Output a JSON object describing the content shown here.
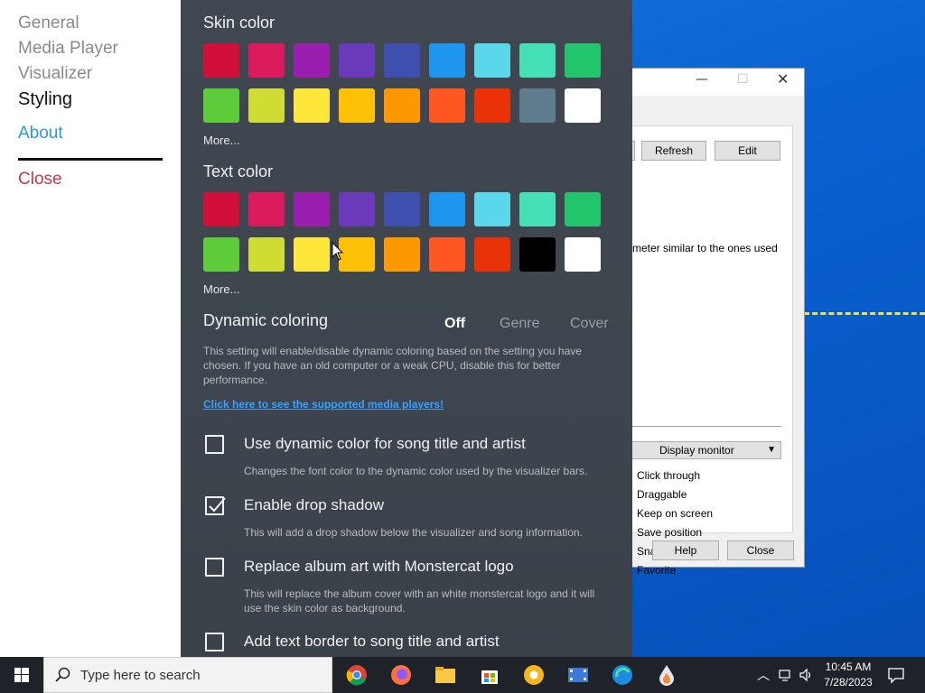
{
  "nav": {
    "general": "General",
    "media_player": "Media Player",
    "visualizer": "Visualizer",
    "styling": "Styling",
    "about": "About",
    "close": "Close"
  },
  "skin_color": {
    "title": "Skin color",
    "more": "More...",
    "swatches": [
      "#d0103a",
      "#dc1b5e",
      "#9a1fae",
      "#6a3abb",
      "#3f4fb0",
      "#1e96f0",
      "#5bd7ec",
      "#45e0b6",
      "#22c56c",
      "#5ecb3a",
      "#cfdc34",
      "#fee73a",
      "#fec106",
      "#fe9800",
      "#fe5722",
      "#ea3208",
      "#5f7d8c",
      "#ffffff"
    ]
  },
  "text_color": {
    "title": "Text color",
    "more": "More...",
    "swatches": [
      "#d0103a",
      "#dc1b5e",
      "#9a1fae",
      "#6a3abb",
      "#3f4fb0",
      "#1e96f0",
      "#5bd7ec",
      "#45e0b6",
      "#22c56c",
      "#5ecb3a",
      "#cfdc34",
      "#fee73a",
      "#fec106",
      "#fe9800",
      "#fe5722",
      "#ea3208",
      "#000000",
      "#ffffff"
    ]
  },
  "dynamic": {
    "title": "Dynamic coloring",
    "options": [
      "Off",
      "Genre",
      "Cover"
    ],
    "selected": "Off",
    "description": "This setting will enable/disable dynamic coloring based on the setting you have chosen.  If you have an old computer or a weak CPU, disable this for better performance.",
    "link": "Click here to see the supported media players!"
  },
  "options": [
    {
      "label": "Use dynamic color for song title and artist",
      "desc": "Changes the font color to the dynamic color used by the visualizer bars.",
      "checked": false
    },
    {
      "label": "Enable drop shadow",
      "desc": "This will add a drop shadow below the visualizer and song information.",
      "checked": true
    },
    {
      "label": "Replace album art with Monstercat logo",
      "desc": "This will replace the album cover with an white monstercat logo and it will use the skin color as background.",
      "checked": false
    },
    {
      "label": "Add text border to song title and artist",
      "desc": "",
      "checked": false
    }
  ],
  "dialog": {
    "refresh": "Refresh",
    "edit": "Edit",
    "desc_fragment": "meter similar to the ones used",
    "display_monitor": "Display monitor",
    "checks": [
      "Click through",
      "Draggable",
      "Keep on screen",
      "Save position",
      "Snap to edges",
      "Favorite"
    ],
    "help": "Help",
    "close": "Close"
  },
  "taskbar": {
    "search_placeholder": "Type here to search",
    "time": "10:45 AM",
    "date": "7/28/2023",
    "apps": [
      "chrome-icon",
      "firefox-icon",
      "file-explorer-icon",
      "store-icon",
      "chrome-canary-icon",
      "film-icon",
      "edge-icon",
      "rainmeter-icon"
    ]
  }
}
